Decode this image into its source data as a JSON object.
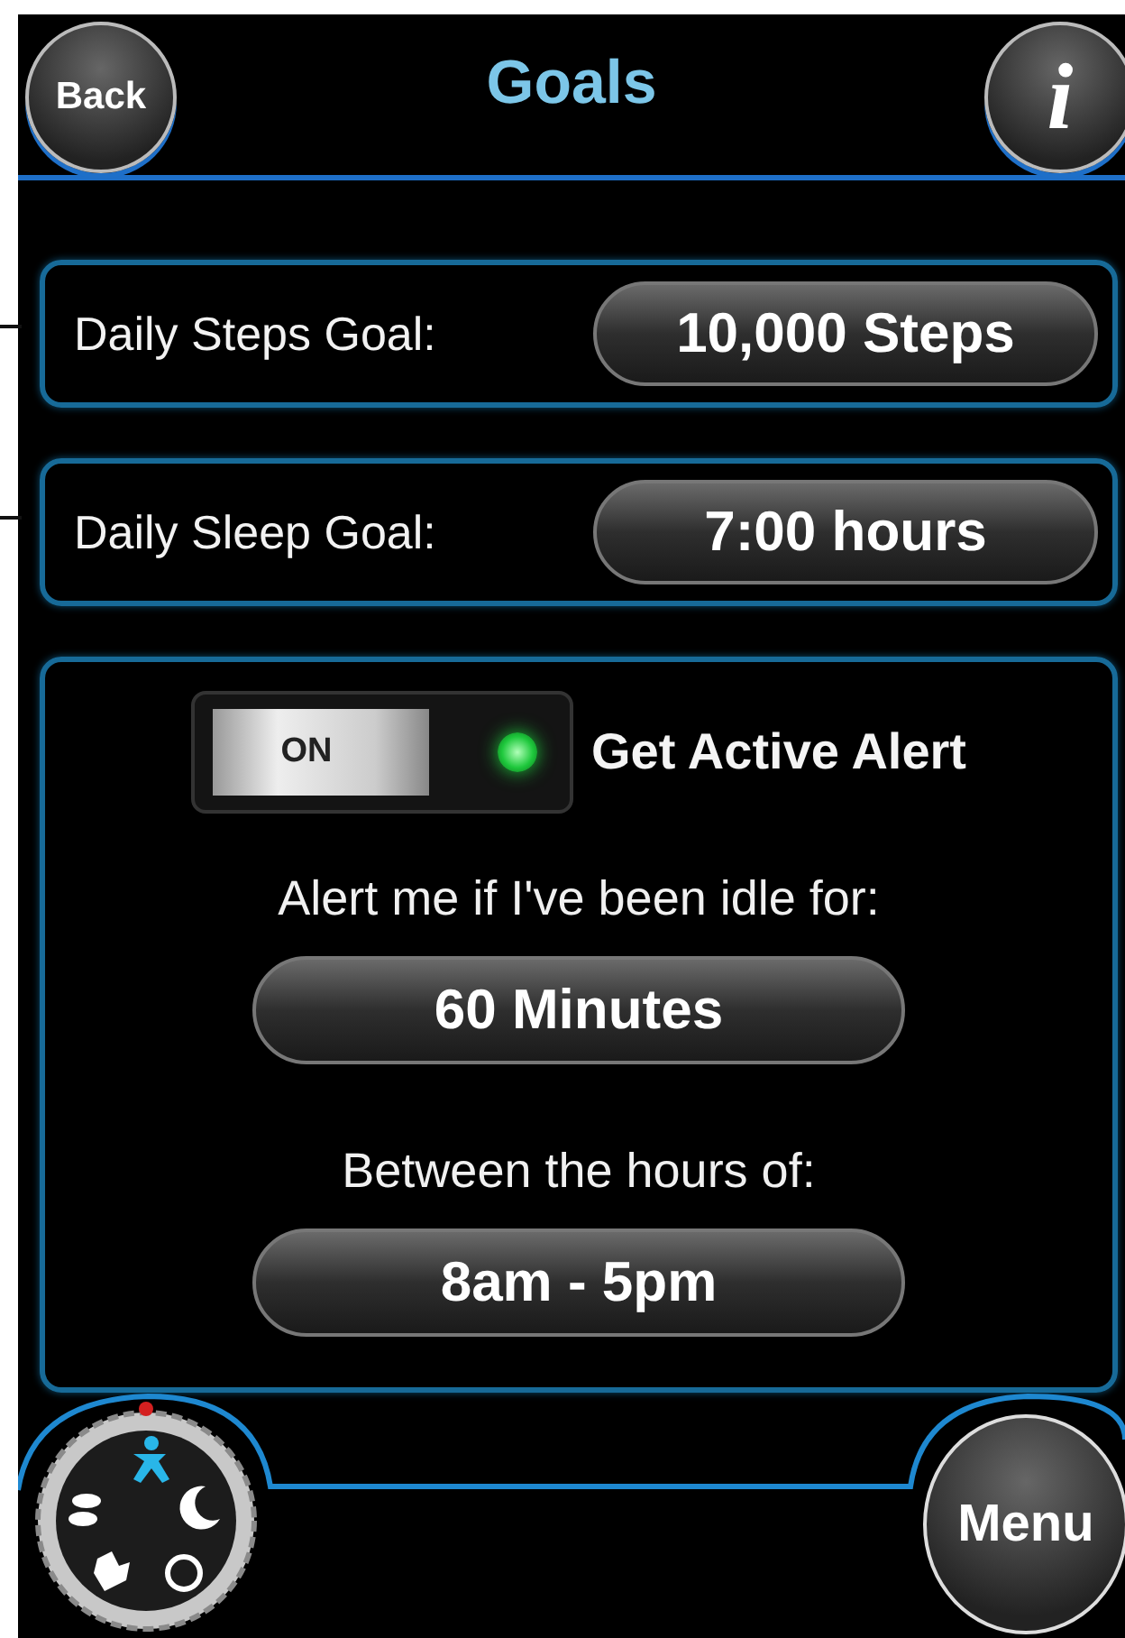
{
  "header": {
    "back_button": "Back",
    "title": "Goals",
    "info_button": "i"
  },
  "goals": [
    {
      "label": "Daily Steps Goal:",
      "value": "10,000 Steps"
    },
    {
      "label": "Daily Sleep Goal:",
      "value": "7:00 hours"
    }
  ],
  "alert": {
    "switch_label": "ON",
    "on": true,
    "title": "Get Active Alert",
    "idle_label": "Alert me if I've been idle for:",
    "idle_value": "60 Minutes",
    "hours_label": "Between the hours of:",
    "hours_value": "8am - 5pm"
  },
  "menu_button": "Menu"
}
